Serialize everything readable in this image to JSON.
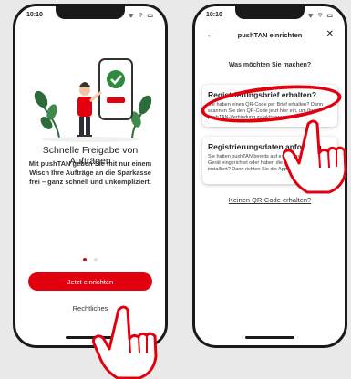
{
  "left_phone": {
    "status": {
      "time": "10:10",
      "icons": "ᯤ ⌔ ▭"
    },
    "title": "Schnelle Freigabe von Aufträgen",
    "body": "Mit pushTAN geben Sie mit nur einem Wisch Ihre Aufträge an die Sparkasse frei – ganz schnell und unkompliziert.",
    "primary_button": "Jetzt einrichten",
    "secondary_link": "Rechtliches",
    "page_indicator": {
      "count": 2,
      "active_index": 0
    }
  },
  "right_phone": {
    "status": {
      "time": "10:10",
      "icons": "ᯤ ⌔ ▭"
    },
    "nav": {
      "back": "←",
      "title": "pushTAN einrichten",
      "close": "✕"
    },
    "question": "Was möchten Sie machen?",
    "cards": [
      {
        "title": "Registrierungsbrief erhalten?",
        "text": "Sie haben einen QR-Code per Brief erhalten? Dann scannen Sie den QR-Code jetzt hier ein, um Ihre pushTAN-Verbindung zu aktivieren.",
        "arrow": "→"
      },
      {
        "title": "Registrierungsdaten anfordern",
        "text": "Sie hatten pushTAN bereits auf einem anderen Gerät eingerichtet oder haben die App neu installiert? Dann richten Sie die App hier neu ein.",
        "arrow": "→"
      }
    ],
    "link": "Keinen QR-Code erhalten?"
  },
  "colors": {
    "accent": "#e2000f",
    "background": "#e9e9e9"
  }
}
